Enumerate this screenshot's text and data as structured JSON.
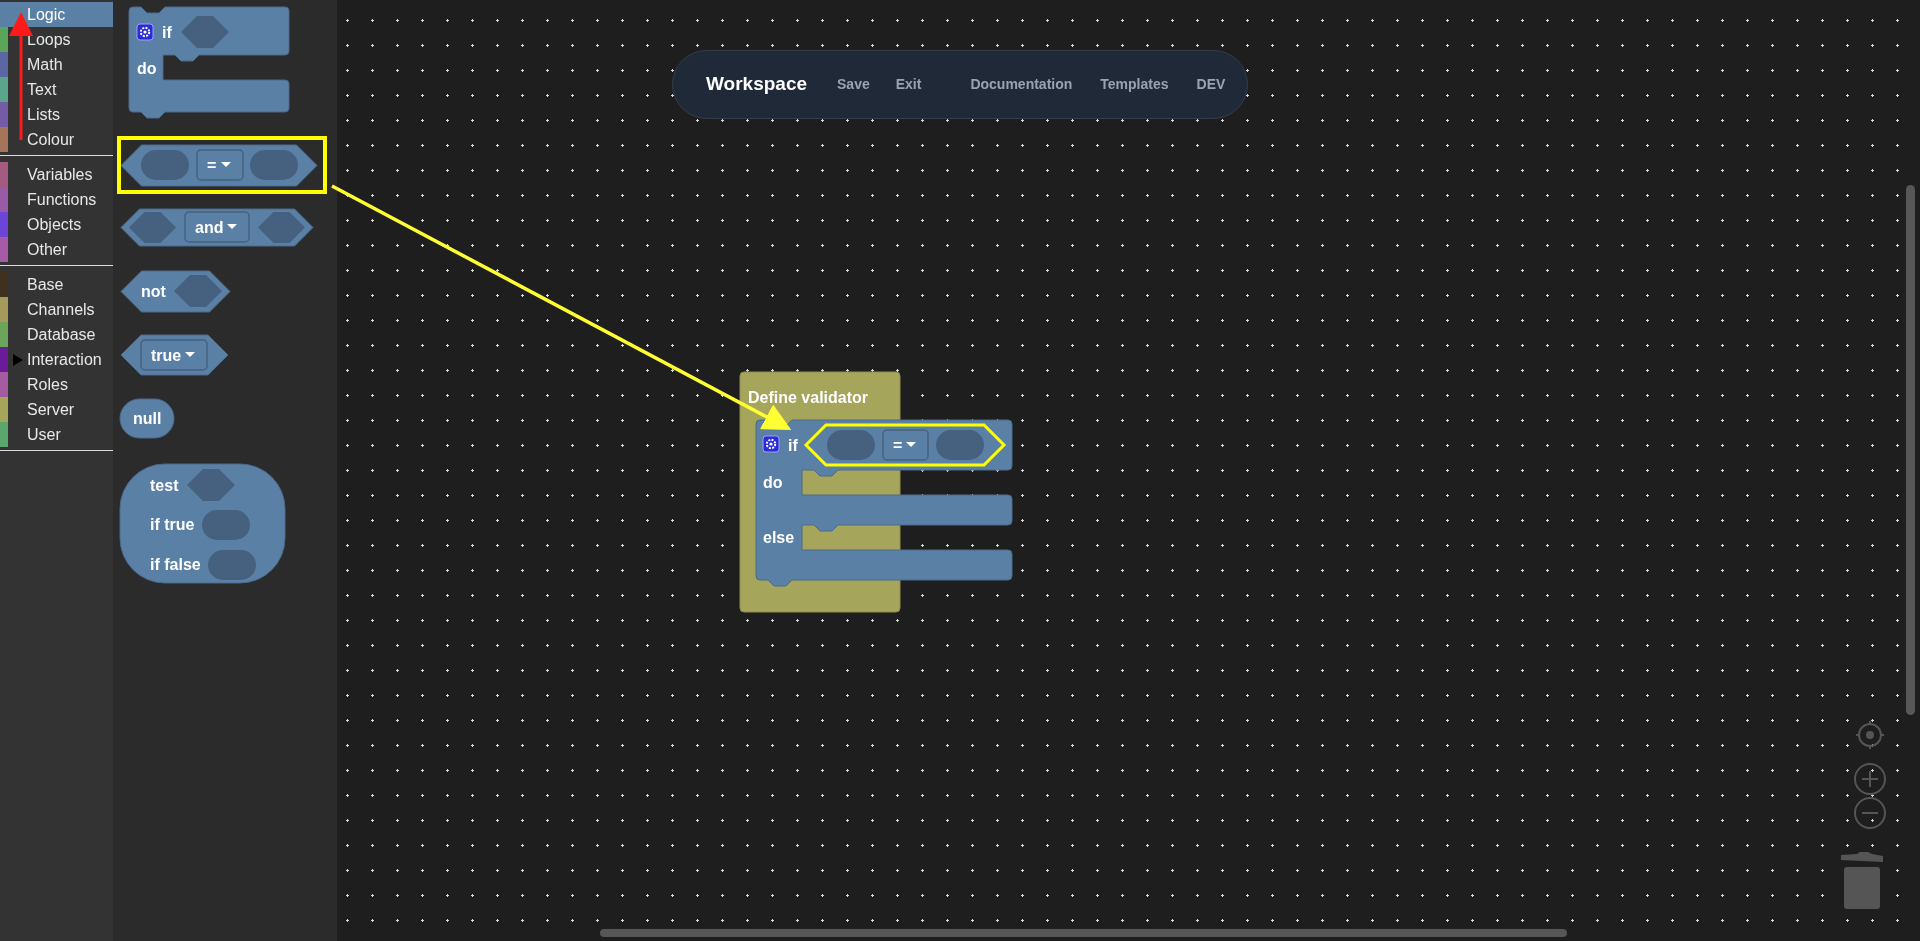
{
  "toolbox": {
    "groups": [
      [
        {
          "label": "Logic",
          "color": "#5b80a5",
          "selected": true,
          "has_children": false
        },
        {
          "label": "Loops",
          "color": "#5ba55b",
          "selected": false,
          "has_children": false
        },
        {
          "label": "Math",
          "color": "#5b67a5",
          "selected": false,
          "has_children": false
        },
        {
          "label": "Text",
          "color": "#5ba58c",
          "selected": false,
          "has_children": false
        },
        {
          "label": "Lists",
          "color": "#745ba5",
          "selected": false,
          "has_children": false
        },
        {
          "label": "Colour",
          "color": "#a5745b",
          "selected": false,
          "has_children": false
        }
      ],
      [
        {
          "label": "Variables",
          "color": "#a55b80",
          "selected": false,
          "has_children": false
        },
        {
          "label": "Functions",
          "color": "#995ba5",
          "selected": false,
          "has_children": false
        },
        {
          "label": "Objects",
          "color": "#6a45d8",
          "selected": false,
          "has_children": false
        },
        {
          "label": "Other",
          "color": "#a55ba5",
          "selected": false,
          "has_children": false
        }
      ],
      [
        {
          "label": "Base",
          "color": "#3f301f",
          "selected": false,
          "has_children": false
        },
        {
          "label": "Channels",
          "color": "#a59a5b",
          "selected": false,
          "has_children": false
        },
        {
          "label": "Database",
          "color": "#6aa55b",
          "selected": false,
          "has_children": false
        },
        {
          "label": "Interaction",
          "color": "#6a1b9a",
          "selected": false,
          "has_children": true
        },
        {
          "label": "Roles",
          "color": "#a55ba0",
          "selected": false,
          "has_children": false
        },
        {
          "label": "Server",
          "color": "#a5a55b",
          "selected": false,
          "has_children": false
        },
        {
          "label": "User",
          "color": "#5ba56f",
          "selected": false,
          "has_children": false
        }
      ]
    ]
  },
  "flyout": {
    "blocks": [
      {
        "kind": "if",
        "labels": [
          "if",
          "do"
        ]
      },
      {
        "kind": "compare",
        "operator": "=",
        "highlighted": true
      },
      {
        "kind": "logic_operation",
        "operator": "and"
      },
      {
        "kind": "negate",
        "label": "not"
      },
      {
        "kind": "boolean",
        "value": "true"
      },
      {
        "kind": "null",
        "label": "null"
      },
      {
        "kind": "ternary",
        "labels": [
          "test",
          "if true",
          "if false"
        ]
      }
    ]
  },
  "menu": {
    "title": "Workspace",
    "actions": [
      "Save",
      "Exit"
    ],
    "links": [
      "Documentation",
      "Templates",
      "DEV"
    ]
  },
  "workspace": {
    "define_block": {
      "label": "Define validator",
      "if_block": {
        "labels": [
          "if",
          "do",
          "else"
        ],
        "condition": {
          "operator": "=",
          "highlighted": true
        }
      }
    }
  }
}
